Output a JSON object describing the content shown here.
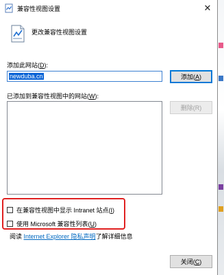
{
  "window": {
    "title": "兼容性视图设置",
    "close_glyph": "✕"
  },
  "header": {
    "text": "更改兼容性视图设置"
  },
  "add_section": {
    "label_prefix": "添加此网站(",
    "label_key": "D",
    "label_suffix": "):",
    "input_value": "newduba.cn",
    "add_button_prefix": "添加(",
    "add_button_key": "A",
    "add_button_suffix": ")"
  },
  "list_section": {
    "label_prefix": "已添加到兼容性视图中的网站(",
    "label_key": "W",
    "label_suffix": "):",
    "items": [],
    "remove_button_prefix": "删除(",
    "remove_button_key": "R",
    "remove_button_suffix": ")"
  },
  "options": {
    "intranet": {
      "label_prefix": "在兼容性视图中显示 Intranet 站点(",
      "label_key": "I",
      "label_suffix": ")",
      "checked": false
    },
    "ms_list": {
      "label_prefix": "使用 Microsoft 兼容性列表(",
      "label_key": "U",
      "label_suffix": ")",
      "checked": false
    }
  },
  "privacy": {
    "prefix": "阅读 ",
    "link_text": "Internet Explorer 隐私声明",
    "suffix": "了解详细信息"
  },
  "footer": {
    "close_prefix": "关闭(",
    "close_key": "C",
    "close_suffix": ")"
  },
  "icons": {
    "title": "compatibility-view-icon",
    "header": "compatibility-document-icon",
    "close": "close-icon"
  },
  "colors": {
    "selection": "#0a64d6",
    "link": "#0067c0",
    "highlight_box": "#e02020",
    "primary_border": "#0078d7"
  }
}
